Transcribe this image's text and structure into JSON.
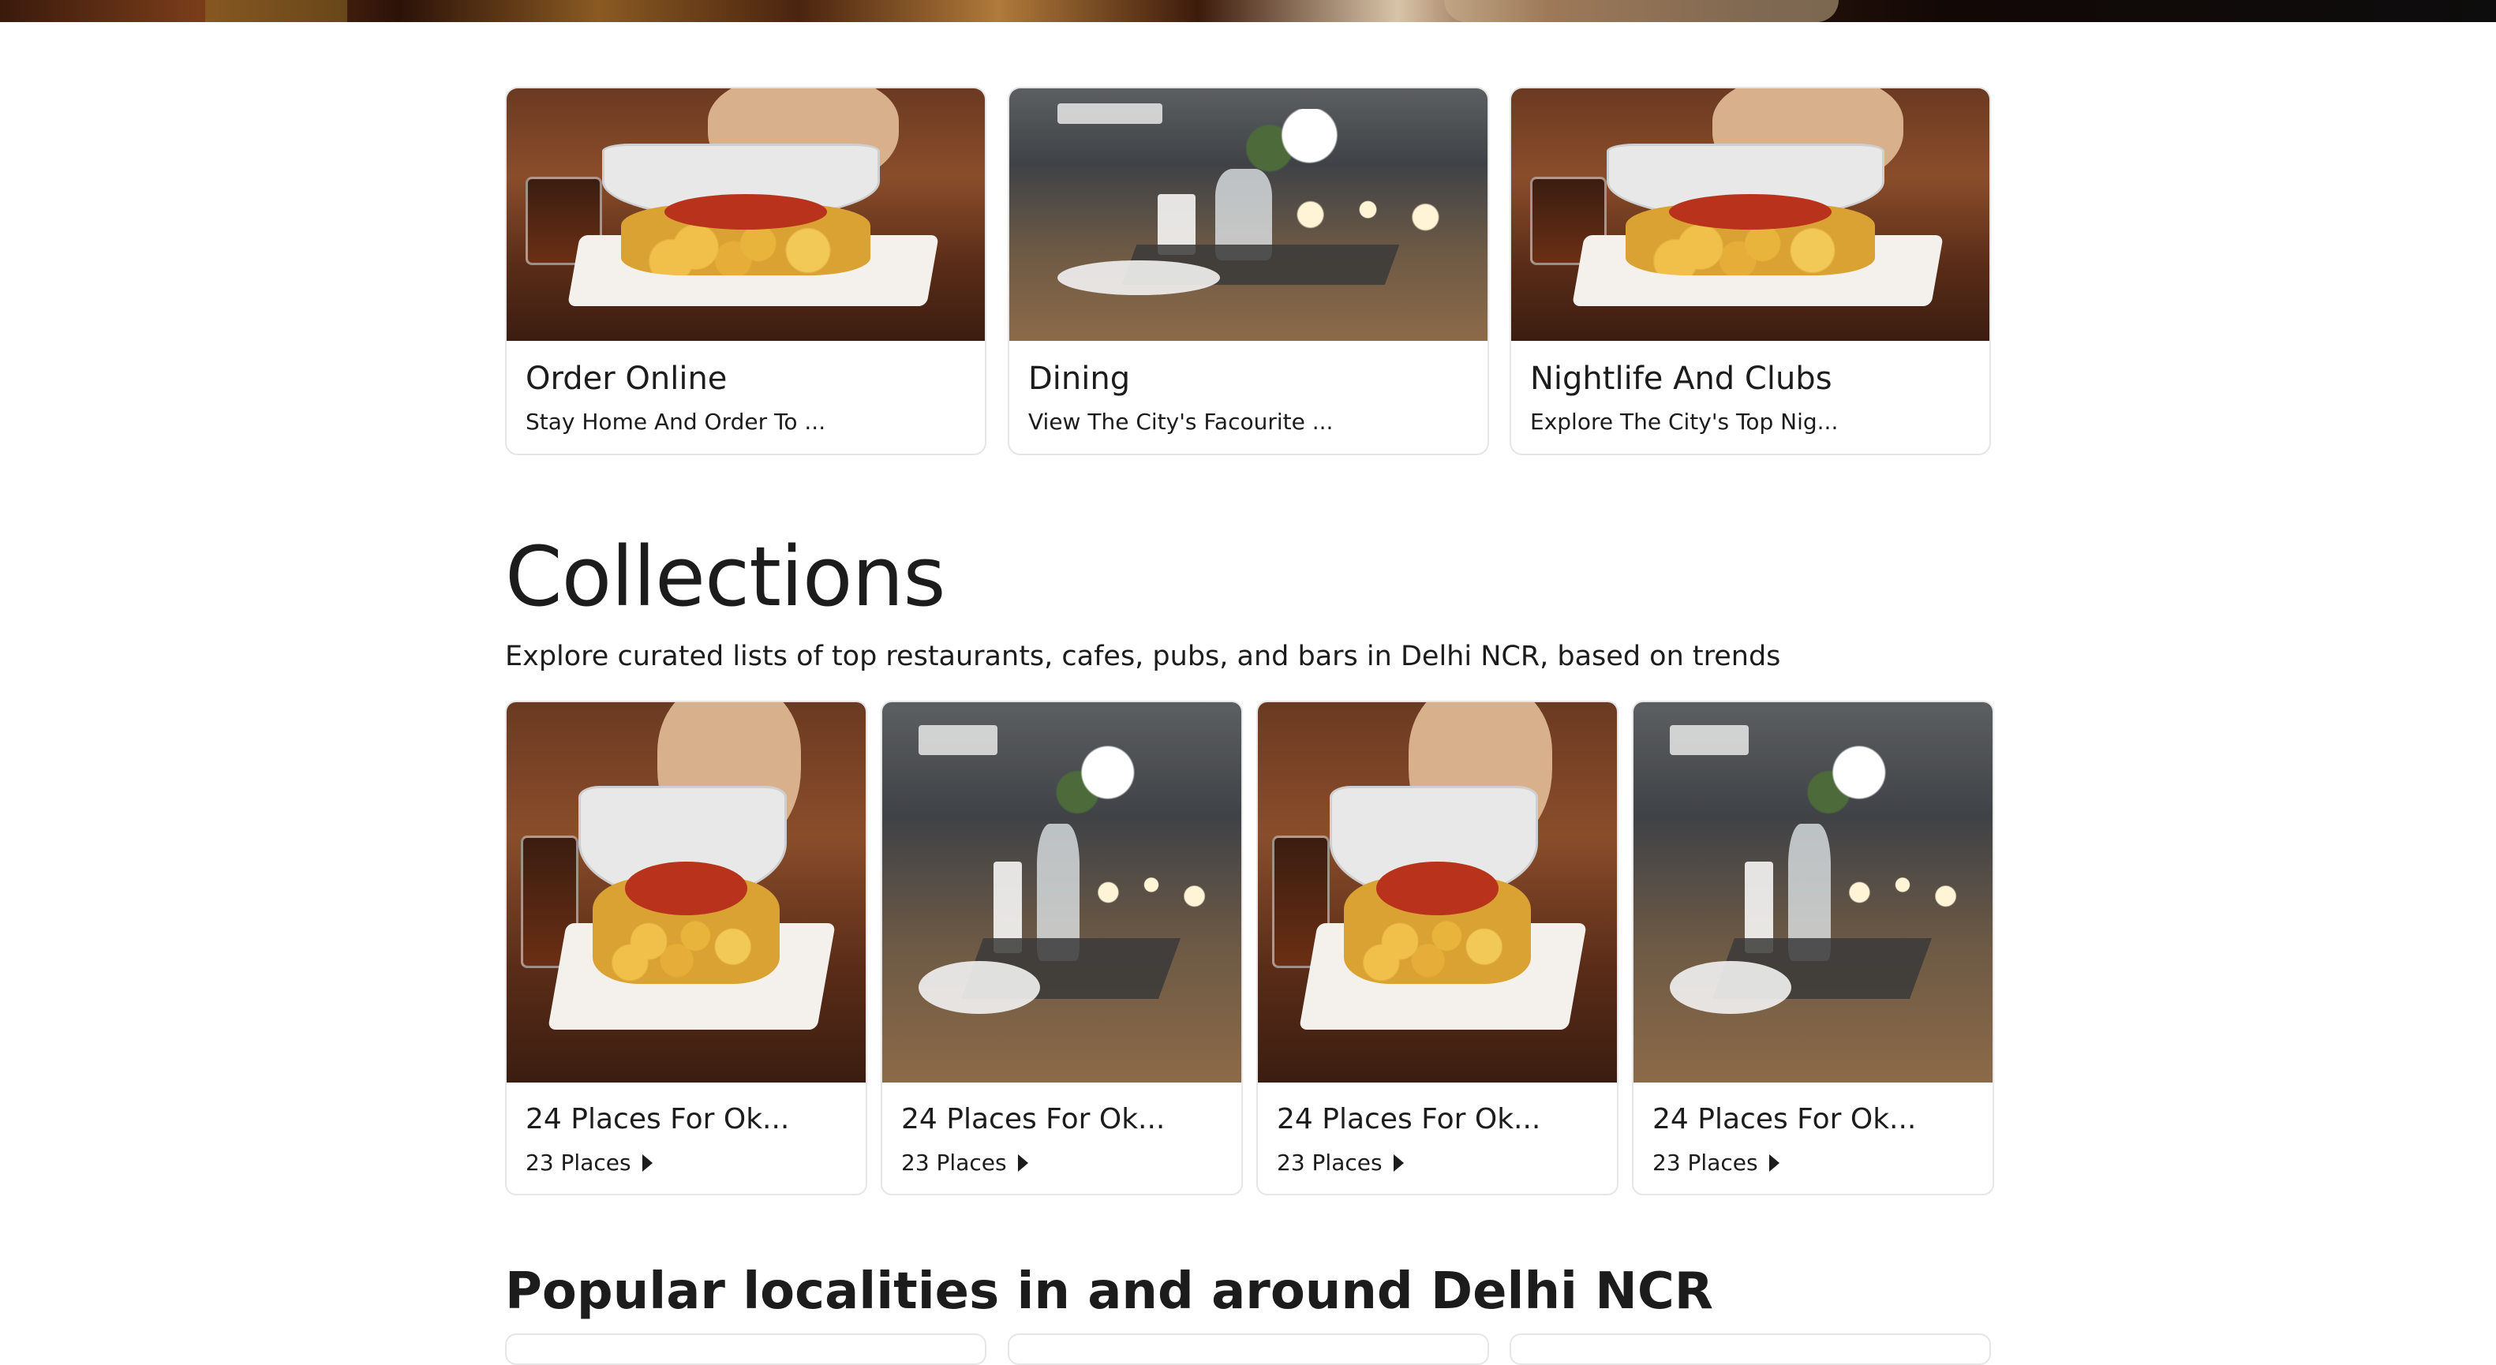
{
  "categories": [
    {
      "title": "Order Online",
      "subtitle": "Stay Home And Order To ...",
      "image": "food"
    },
    {
      "title": "Dining",
      "subtitle": "View The City's Facourite ...",
      "image": "dining"
    },
    {
      "title": "Nightlife And Clubs",
      "subtitle": "Explore The City's Top Nig...",
      "image": "food"
    }
  ],
  "collections": {
    "heading": "Collections",
    "subheading": "Explore curated lists of top restaurants, cafes, pubs, and bars in Delhi NCR, based on trends",
    "items": [
      {
        "title": "24 Places For Ok...",
        "count": "23 Places",
        "image": "food"
      },
      {
        "title": "24 Places For Ok...",
        "count": "23 Places",
        "image": "dining"
      },
      {
        "title": "24 Places For Ok...",
        "count": "23 Places",
        "image": "food"
      },
      {
        "title": "24 Places For Ok...",
        "count": "23 Places",
        "image": "dining"
      }
    ]
  },
  "localities": {
    "heading_prefix": "Popular localities in and around ",
    "heading_city": "Delhi NCR"
  }
}
